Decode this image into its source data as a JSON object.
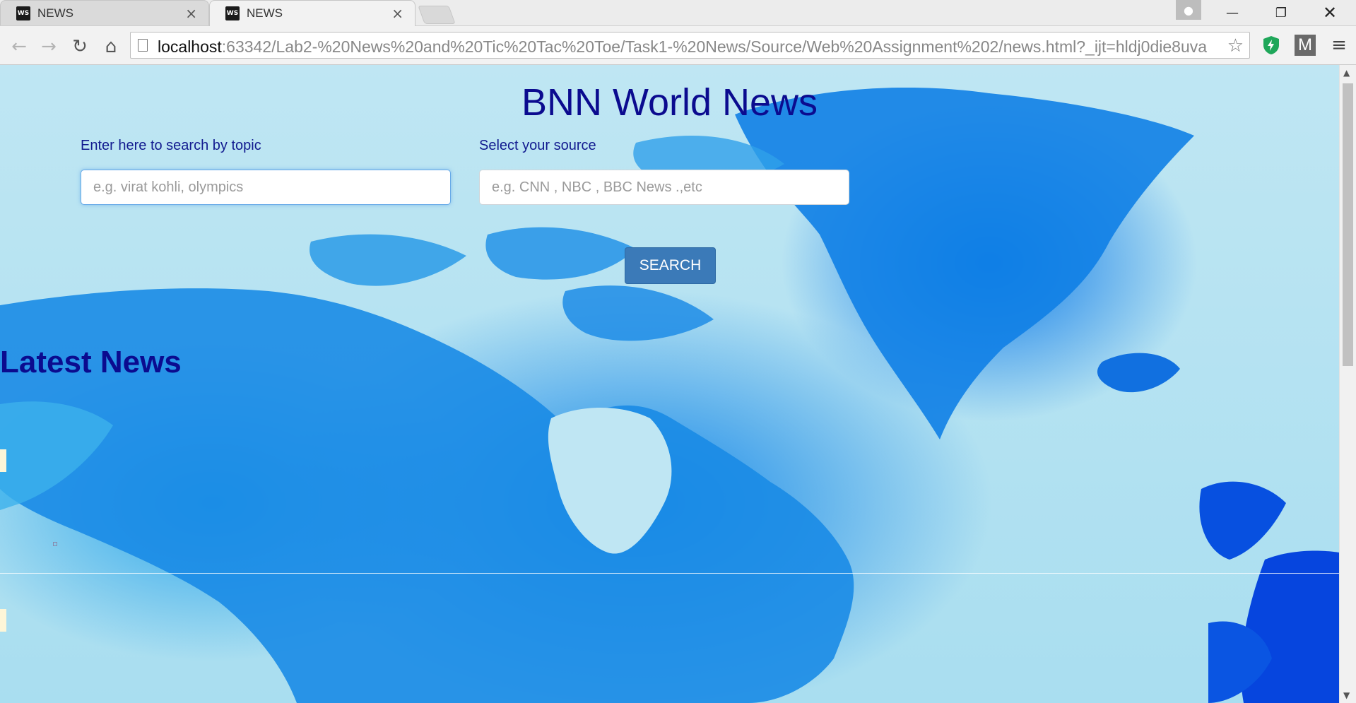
{
  "browser": {
    "tabs": [
      {
        "title": "NEWS",
        "favicon": "WS"
      },
      {
        "title": "NEWS",
        "favicon": "WS"
      }
    ],
    "url_host": "localhost",
    "url_rest": ":63342/Lab2-%20News%20and%20Tic%20Tac%20Toe/Task1-%20News/Source/Web%20Assignment%202/news.html?_ijt=hldj0die8uva",
    "extension_m": "M"
  },
  "page": {
    "heading": "BNN World News",
    "topic_label": "Enter here to search by topic",
    "topic_placeholder": "e.g. virat kohli, olympics",
    "source_label": "Select your source",
    "source_placeholder": "e.g. CNN , NBC , BBC News .,etc",
    "search_button": "SEARCH",
    "latest_heading": "Latest News"
  }
}
